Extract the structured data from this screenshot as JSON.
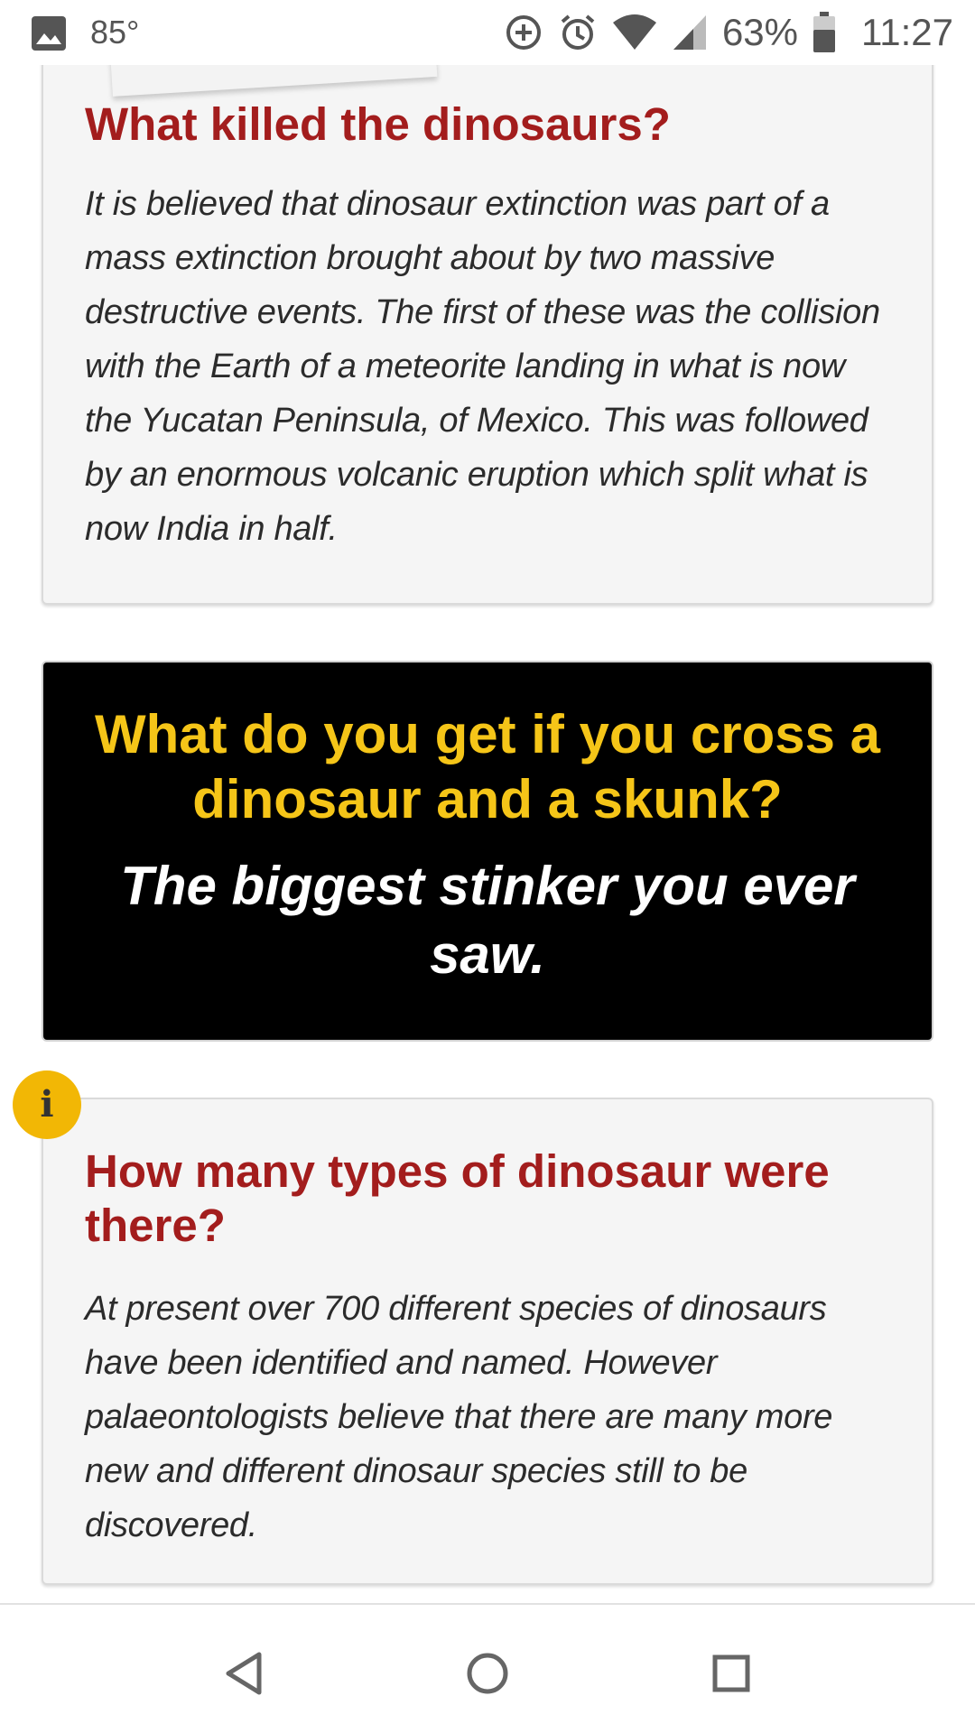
{
  "status_bar": {
    "temperature": "85°",
    "battery": "63%",
    "time": "11:27",
    "icons": [
      "gallery-icon",
      "data-saver-icon",
      "alarm-icon",
      "wifi-icon",
      "signal-icon",
      "battery-icon"
    ]
  },
  "cards": [
    {
      "title": "What killed the dinosaurs?",
      "body": "It is believed that dinosaur extinction was part of a mass extinction brought about by two massive destructive events. The first of these was the collision with the Earth of a meteorite landing in what is now the Yucatan Peninsula, of Mexico. This was followed by an enormous volcanic eruption which split what is now India in half."
    },
    {
      "title": "How many types of dinosaur were there?",
      "body": "At present over 700 different species of dinosaurs have been identified and named. However palaeontologists believe that there are many more new and different dinosaur species still to be discovered."
    }
  ],
  "joke": {
    "question": "What do you get if you cross a dinosaur and a skunk?",
    "answer": "The biggest stinker you ever saw."
  },
  "info_badge": {
    "glyph": "i"
  },
  "colors": {
    "title_red": "#a31d1d",
    "joke_yellow": "#f5c518",
    "badge_yellow": "#f2b705",
    "card_bg": "#f5f5f5",
    "joke_bg": "#000000"
  },
  "nav": {
    "icons": [
      "back-icon",
      "home-icon",
      "recents-icon"
    ]
  }
}
